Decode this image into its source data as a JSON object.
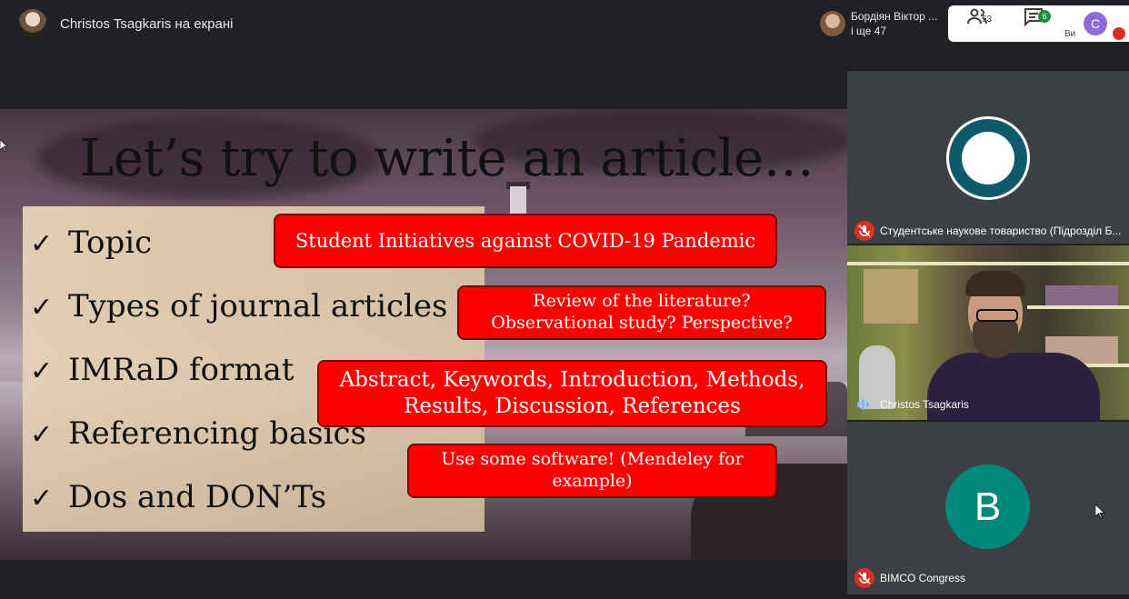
{
  "header": {
    "presenter_title": "Christos Tsagkaris на екрані"
  },
  "participants_chip": {
    "name": "Бордіян Віктор ...",
    "more": "і ще 47"
  },
  "controls": {
    "people_count": "53",
    "chat_badge": "6",
    "self_initial": "C",
    "self_label": "Ви",
    "people_icon": "people-icon",
    "chat_icon": "chat-icon"
  },
  "slide": {
    "title": "Let’s try to write an article…",
    "items": [
      "Topic",
      "Types of journal articles",
      "IMRaD format",
      "Referencing basics",
      "Dos and DON’Ts"
    ],
    "check_glyph": "✓",
    "callouts": [
      {
        "lines": [
          "Student Initiatives against COVID-19 Pandemic"
        ]
      },
      {
        "lines": [
          "Review of the literature?",
          "Observational study? Perspective?"
        ]
      },
      {
        "lines": [
          "Abstract, Keywords, Introduction, Methods,",
          "Results, Discussion, References"
        ]
      },
      {
        "lines": [
          "Use some software! (Mendeley for",
          "example)"
        ]
      }
    ]
  },
  "tiles": [
    {
      "name": "Студентське наукове товариство (Підрозділ Б...",
      "muted": true
    },
    {
      "name": "Christos Tsagkaris",
      "speaking": true
    },
    {
      "name": "BIMCO Congress",
      "muted": true,
      "initial": "B"
    }
  ],
  "colors": {
    "callout_red": "#ff0000",
    "mute_red": "#d93025",
    "avatar_teal": "#00897b",
    "self_purple": "#8e6bd8"
  }
}
